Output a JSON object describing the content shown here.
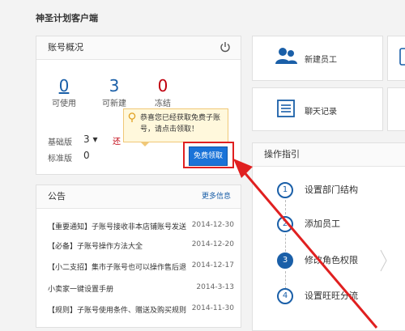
{
  "app": {
    "title": "神圣计划客户端"
  },
  "account": {
    "title": "账号概况",
    "stats": [
      {
        "value": "0",
        "label": "可使用"
      },
      {
        "value": "3",
        "label": "可新建"
      },
      {
        "value": "0",
        "label": "冻结"
      }
    ],
    "basic_label": "基础版",
    "basic_value": "3 ▾",
    "basic_extra": "还",
    "standard_label": "标准版",
    "standard_value": "0",
    "tooltip": "恭喜您已经获取免费子账号，请点击领取！",
    "free_button": "免费领取"
  },
  "notice": {
    "title": "公告",
    "more": "更多信息",
    "items": [
      {
        "text": "【重要通知】子账号接收非本店铺账号发送",
        "date": "2014-12-30"
      },
      {
        "text": "【必备】子账号操作方法大全",
        "date": "2014-12-20"
      },
      {
        "text": "【小二支招】集市子账号也可以操作售后退",
        "date": "2014-12-17"
      },
      {
        "text": "小卖家一键设置手册",
        "date": "2014-3-13"
      },
      {
        "text": "【规则】子账号使用条件、赠送及购买规则",
        "date": "2014-11-30"
      }
    ]
  },
  "quick": {
    "new_staff": "新建员工",
    "chat_log": "聊天记录"
  },
  "guide": {
    "title": "操作指引",
    "steps": [
      {
        "num": "1",
        "label": "设置部门结构"
      },
      {
        "num": "2",
        "label": "添加员工"
      },
      {
        "num": "3",
        "label": "修改角色权限"
      },
      {
        "num": "4",
        "label": "设置旺旺分流"
      }
    ]
  },
  "colors": {
    "accent": "#1a5fa8",
    "button": "#1a73d8",
    "alert": "#c0000e",
    "annotation": "#e02020"
  }
}
